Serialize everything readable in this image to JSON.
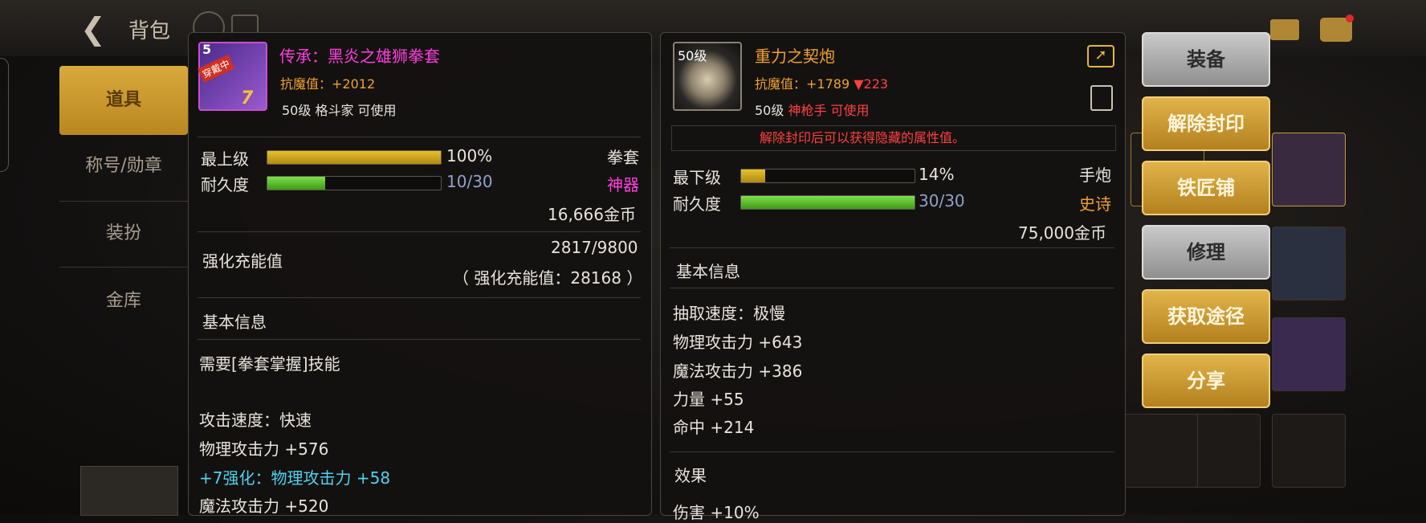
{
  "topbar": {
    "title": "背包"
  },
  "left_nav": {
    "items": [
      "道具",
      "称号/勋章",
      "装扮",
      "金库"
    ]
  },
  "panel_left": {
    "level_badge": "5",
    "icon_tag": "穿戴中",
    "enhance_badge": "7",
    "name": "传承：黑炎之雄狮拳套",
    "anti_magic_label": "抗魔值：",
    "anti_magic_value": "+2012",
    "requirement": "50级 格斗家 可使用",
    "grade_label": "最上级",
    "grade_fill": 1.0,
    "grade_value": "100%",
    "weapon_type": "拳套",
    "durability_label": "耐久度",
    "durability_fill": 0.333,
    "durability_value": "10/30",
    "rarity": "神器",
    "price": "16,666金币",
    "charge_label": "强化充能值",
    "charge_value": "2817/9800",
    "charge_note": "（ 强化充能值：28168 ）",
    "basic_info": "基本信息",
    "lines": [
      {
        "text": "需要[拳套掌握]技能",
        "color": "#e8e4dc"
      },
      {
        "text": "",
        "color": "#e8e4dc"
      },
      {
        "text": "攻击速度：快速",
        "color": "#e8e4dc"
      },
      {
        "text": "物理攻击力 +576",
        "color": "#e8e4dc"
      },
      {
        "text": "+7强化：物理攻击力 +58",
        "color": "#4fd2ee"
      },
      {
        "text": "魔法攻击力 +520",
        "color": "#e8e4dc"
      }
    ]
  },
  "panel_right": {
    "level_badge": "50级",
    "name": "重力之契炮",
    "anti_magic_label": "抗魔值：",
    "anti_magic_value": "+1789",
    "anti_magic_diff": "▼223",
    "req_level": "50级",
    "req_class": "神枪手 可使用",
    "seal_notice": "解除封印后可以获得隐藏的属性值。",
    "grade_label": "最下级",
    "grade_fill": 0.14,
    "grade_value": "14%",
    "weapon_type": "手炮",
    "durability_label": "耐久度",
    "durability_fill": 1.0,
    "durability_value": "30/30",
    "rarity": "史诗",
    "price": "75,000金币",
    "basic_info": "基本信息",
    "lines": [
      "抽取速度：极慢",
      "物理攻击力 +643",
      "魔法攻击力 +386",
      "力量 +55",
      "命中 +214"
    ],
    "effect_label": "效果",
    "effect_line": "伤害 +10%"
  },
  "buttons": [
    "装备",
    "解除封印",
    "铁匠铺",
    "修理",
    "获取途径",
    "分享"
  ],
  "colors": {
    "accent_gold": "#d9a93c",
    "legend_pink": "#ff3fe0",
    "epic_orange": "#f0a030",
    "warn_red": "#ff4040",
    "enhance_cyan": "#4fd2ee"
  }
}
